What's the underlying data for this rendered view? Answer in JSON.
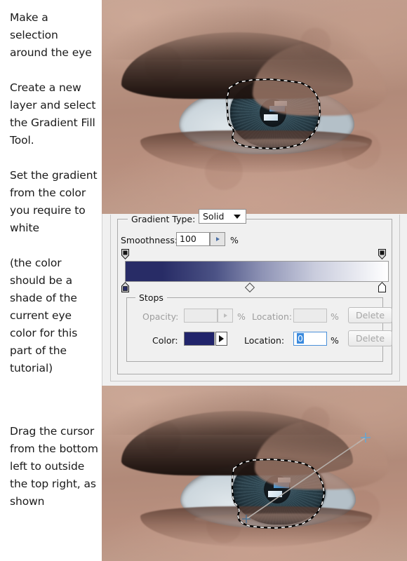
{
  "tutorial": {
    "steps": [
      "Make a selection around the eye",
      "Create a new layer and select the Gradient Fill Tool.",
      "Set the gradient from the color you require to white",
      "(the color should be a shade of the current eye color for this part of the tutorial)",
      "Drag the cursor from the bottom left to outside the top right, as shown"
    ]
  },
  "dialog": {
    "gradient_type_label": "Gradient Type:",
    "gradient_type_value": "Solid",
    "smoothness_label": "Smoothness:",
    "smoothness_value": "100",
    "smoothness_unit": "%",
    "stops_group_label": "Stops",
    "opacity_label": "Opacity:",
    "opacity_value": "",
    "opacity_unit": "%",
    "opacity_location_label": "Location:",
    "opacity_location_value": "",
    "opacity_location_unit": "%",
    "opacity_delete_label": "Delete",
    "color_label": "Color:",
    "color_location_label": "Location:",
    "color_location_value": "0",
    "color_location_unit": "%",
    "color_delete_label": "Delete",
    "color_swatch_hex": "#21246b",
    "gradient_start_hex": "#282c66",
    "gradient_end_hex": "#ffffff",
    "gradient_midpoint_percent": 50,
    "opacity_stop_left_percent": 0,
    "opacity_stop_right_percent": 100,
    "color_stop_left_percent": 0,
    "color_stop_right_percent": 100
  },
  "images": {
    "top": {
      "alt": "Close-up photo of an eye with a marching-ants selection around the iris",
      "selection_label": "marching-ants-selection"
    },
    "bottom": {
      "alt": "Close-up photo of an eye with selection and a gradient drag line",
      "selection_label": "marching-ants-selection",
      "drag_line_label": "gradient-drag-line",
      "drag_from": "bottom left of iris",
      "drag_to": "outside top right"
    }
  },
  "colors": {
    "skin": "#b08d7f",
    "sclera": "#c8d3da",
    "iris": "#2f4853",
    "accent_blue": "#3a8ade",
    "dialog_bg": "#f0f0f0"
  }
}
